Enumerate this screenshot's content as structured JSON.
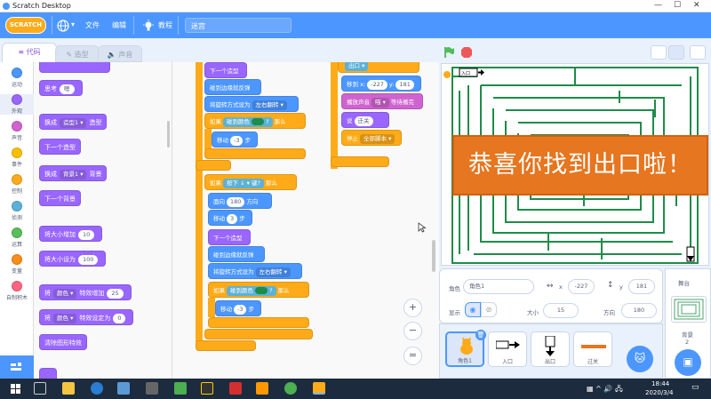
{
  "window": {
    "title": "Scratch Desktop",
    "min": "—",
    "max": "☐",
    "close": "✕"
  },
  "menubar": {
    "logo": "SCRATCH",
    "file": "文件",
    "edit": "编辑",
    "tutorials": "教程",
    "project_title": "迷宫"
  },
  "tabs": {
    "code": "代码",
    "costumes": "造型",
    "sounds": "声音"
  },
  "categories": [
    {
      "label": "运动",
      "color": "#4c97ff"
    },
    {
      "label": "外观",
      "color": "#9966ff"
    },
    {
      "label": "声音",
      "color": "#cf63cf"
    },
    {
      "label": "事件",
      "color": "#ffbf00"
    },
    {
      "label": "控制",
      "color": "#ffab19"
    },
    {
      "label": "侦测",
      "color": "#5cb1d6"
    },
    {
      "label": "运算",
      "color": "#59c059"
    },
    {
      "label": "变量",
      "color": "#ff8c1a"
    },
    {
      "label": "自制积木",
      "color": "#ff6680"
    }
  ],
  "palette": {
    "think_label": "思考",
    "think_value": "嗯",
    "switch_costume": "换成",
    "costume_opt": "造型1",
    "costume_suffix": "造型",
    "next_costume": "下一个造型",
    "switch_backdrop": "换成",
    "backdrop_opt": "背景1",
    "backdrop_suffix": "背景",
    "next_backdrop": "下一个背景",
    "size_change": "将大小增加",
    "size_change_val": "10",
    "size_set": "将大小设为",
    "size_set_val": "100",
    "effect_change": "将",
    "effect_opt": "颜色",
    "effect_change_mid": "特效增加",
    "effect_change_val": "25",
    "effect_set": "将",
    "effect_set_opt": "颜色",
    "effect_set_mid": "特效设定为",
    "effect_set_val": "0",
    "clear_effects": "清除图形特效"
  },
  "scripts": {
    "next_costume": "下一个造型",
    "bounce": "碰到边缘就反弹",
    "rotation_style": "将旋转方式设为",
    "rotation_opt": "左右翻转",
    "if": "如果",
    "touching_color": "碰到颜色",
    "q": "?",
    "then": "那么",
    "move": "移动",
    "move_val": "-3",
    "steps": "步",
    "key_pressed": "按下",
    "key_opt": "↓",
    "key_suffix": "键?",
    "point_dir": "面向",
    "dir_val": "180",
    "dir_suffix": "方向",
    "move2_val": "3",
    "goto": "移到 x:",
    "goto_x": "-227",
    "goto_y_label": "y:",
    "goto_y": "181",
    "play_sound": "播放声音",
    "sound_opt": "喵",
    "wait_done": "等待播完",
    "say": "说",
    "say_val": "迁关",
    "stop": "停止",
    "stop_opt": "全部脚本",
    "exit_label": "出口"
  },
  "zoom": {
    "in": "+",
    "out": "−",
    "reset": "="
  },
  "stage": {
    "banner": "恭喜你找到出口啦！",
    "entrance": "入口"
  },
  "sprite_info": {
    "sprite_label": "角色",
    "sprite_name": "角色1",
    "x_label": "x",
    "x_val": "-227",
    "y_label": "y",
    "y_val": "181",
    "show_label": "显示",
    "size_label": "大小",
    "size_val": "15",
    "dir_label": "方向",
    "dir_val": "180"
  },
  "sprites": [
    {
      "name": "角色1"
    },
    {
      "name": "入口"
    },
    {
      "name": "出口"
    },
    {
      "name": "过关"
    }
  ],
  "stage_panel": {
    "title": "舞台",
    "backdrops": "背景",
    "count": "2"
  },
  "taskbar": {
    "time": "18:44",
    "date": "2020/3/4"
  }
}
